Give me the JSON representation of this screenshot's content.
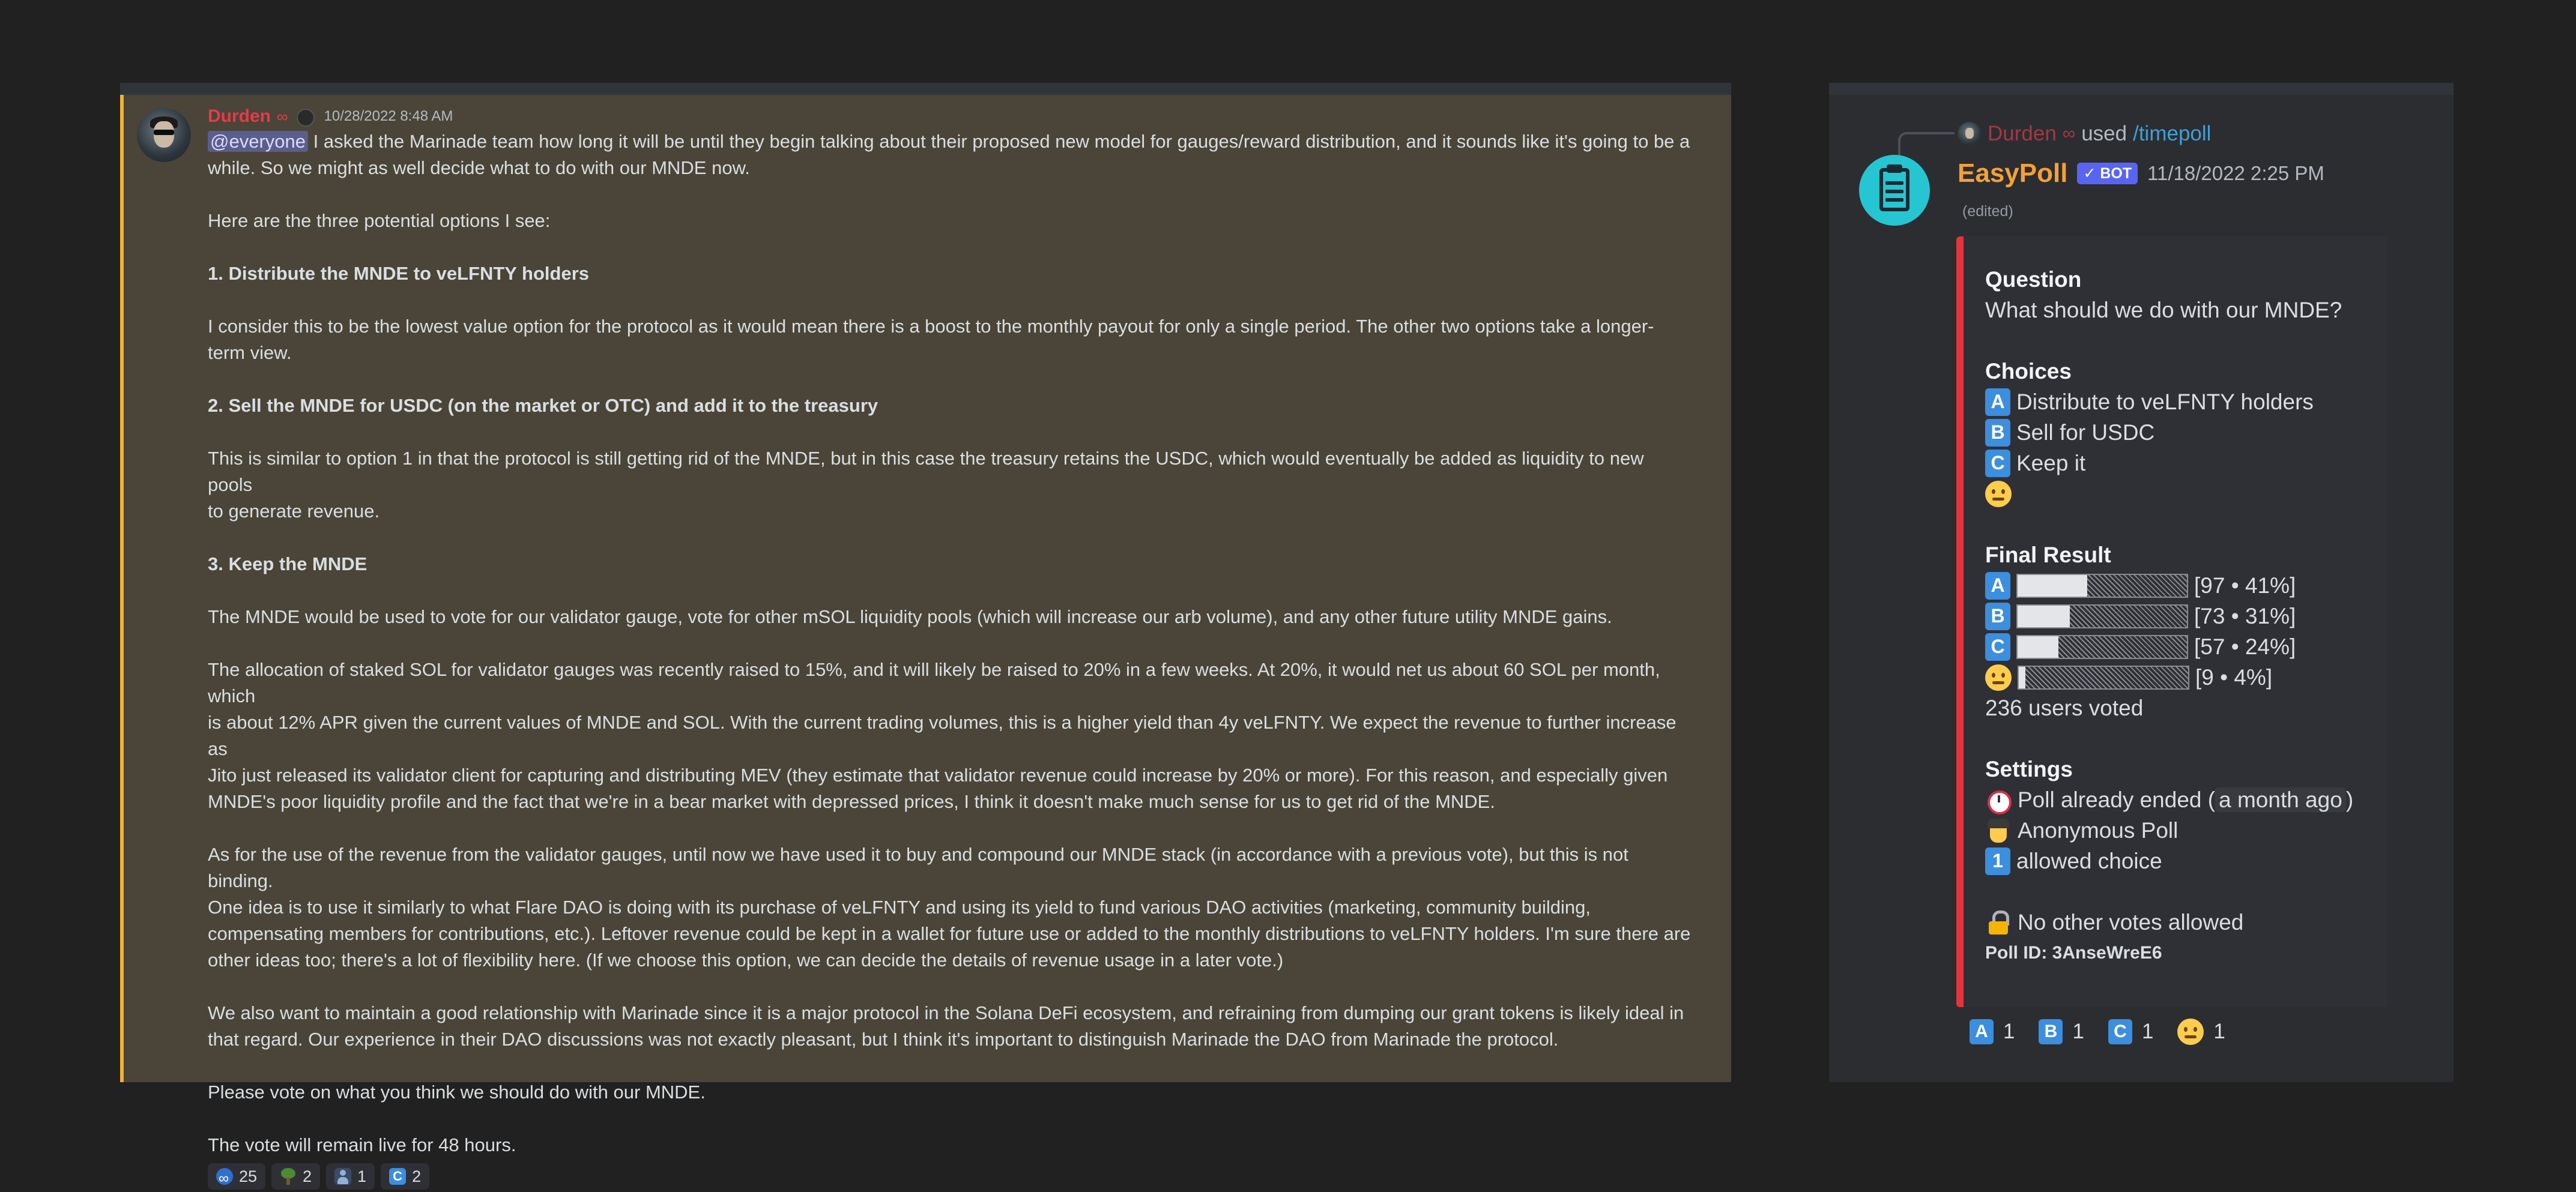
{
  "announcement": {
    "author": "Durden",
    "author_deco": "∞",
    "timestamp": "10/28/2022 8:48 AM",
    "mention": "@everyone",
    "intro_rest": " I asked the Marinade team how long it will be until they begin talking about their proposed new model for gauges/reward distribution, and it sounds like it's going to be a",
    "intro_line2": "while. So we might as well decide what to do with our MNDE now.",
    "options_intro": "Here are the three potential options I see:",
    "opt1_title": "1. Distribute the MNDE to veLFNTY holders",
    "opt1_line1": "I consider this to be the lowest value option for the protocol as it would mean there is a boost to the monthly payout for only a single period. The other two options take a longer-",
    "opt1_line2": "term view.",
    "opt2_title": "2. Sell the MNDE for USDC (on the market or OTC) and add it to the treasury",
    "opt2_line1": "This is similar to option 1 in that the protocol is still getting rid of the MNDE, but in this case the treasury retains the USDC, which would eventually be added as liquidity to new pools",
    "opt2_line2": "to generate revenue.",
    "opt3_title": "3. Keep the MNDE",
    "opt3_line1": "The MNDE would be used to vote for our validator gauge, vote for other mSOL liquidity pools (which will increase our arb volume), and any other future utility MNDE gains.",
    "alloc_line1": "The allocation of staked SOL for validator gauges was recently raised to 15%, and it will likely be raised to 20% in a few weeks. At 20%, it would net us about 60 SOL per month, which",
    "alloc_line2": "is about 12% APR given the current values of MNDE and SOL. With the current trading volumes, this is a higher yield than 4y veLFNTY. We expect the revenue to further increase as",
    "alloc_line3": "Jito just released its validator client for capturing and distributing MEV (they estimate that validator revenue could increase by 20% or more). For this reason, and especially given",
    "alloc_line4": "MNDE's poor liquidity profile and the fact that we're in a bear market with depressed prices, I think it doesn't make much sense for us to get rid of the MNDE.",
    "rev_line1": "As for the use of the revenue from the validator gauges, until now we have used it to buy and compound our MNDE stack (in accordance with a previous vote), but this is not binding.",
    "rev_line2": "One idea is to use it similarly to what Flare DAO is doing with its purchase of veLFNTY and using its yield to fund various DAO activities (marketing, community building,",
    "rev_line3": "compensating members for contributions, etc.). Leftover revenue could be kept in a wallet for future use or added to the monthly distributions to veLFNTY holders. I'm sure there are",
    "rev_line4": "other ideas too; there's a lot of flexibility here. (If we choose this option, we can decide the details of revenue usage in a later vote.)",
    "rel_line1": "We also want to maintain a good relationship with Marinade since it is a major protocol in the Solana DeFi ecosystem, and refraining from dumping our grant tokens is likely ideal in",
    "rel_line2": "that regard. Our experience in their DAO discussions was not exactly pleasant, but I think it's important to distinguish Marinade the DAO from Marinade the protocol.",
    "vote_line": "Please vote on what you think we should do with our MNDE.",
    "live_line": "The vote will remain live for 48 hours.",
    "reactions": [
      {
        "icon": "marinade-icon",
        "count": "25"
      },
      {
        "icon": "tree-icon",
        "count": "2"
      },
      {
        "icon": "person-icon",
        "count": "1"
      },
      {
        "icon": "letter-c-icon",
        "letter": "C",
        "count": "2"
      }
    ]
  },
  "poll": {
    "reply_author": "Durden",
    "reply_deco": "∞",
    "reply_used": "used",
    "reply_command": "/timepoll",
    "bot_name": "EasyPoll",
    "bot_badge": "✓ BOT",
    "bot_time": "11/18/2022 2:25 PM",
    "edited": "(edited)",
    "question_title": "Question",
    "question": "What should we do with our MNDE?",
    "choices_title": "Choices",
    "choices": [
      {
        "letter": "A",
        "label": "Distribute to veLFNTY holders"
      },
      {
        "letter": "B",
        "label": "Sell for USDC"
      },
      {
        "letter": "C",
        "label": "Keep it"
      }
    ],
    "result_title": "Final Result",
    "results": [
      {
        "letter": "A",
        "fraction": 0.41,
        "label": "[97 • 41%]"
      },
      {
        "letter": "B",
        "fraction": 0.31,
        "label": "[73 • 31%]"
      },
      {
        "letter": "C",
        "fraction": 0.24,
        "label": "[57 • 24%]"
      },
      {
        "letter": "",
        "fraction": 0.04,
        "label": "[9 • 4%]"
      }
    ],
    "voted": "236 users voted",
    "settings_title": "Settings",
    "ended_text": "Poll already ended (",
    "ended_ago": "a month ago",
    "ended_close": ")",
    "anonymous": "Anonymous Poll",
    "allowed_num": "1",
    "allowed": "allowed choice",
    "no_votes": "No other votes allowed",
    "poll_id": "Poll ID: 3AnseWreE6",
    "reactions": [
      {
        "letter": "A",
        "count": "1"
      },
      {
        "letter": "B",
        "count": "1"
      },
      {
        "letter": "C",
        "count": "1"
      },
      {
        "letter": "",
        "count": "1"
      }
    ]
  },
  "colors": {
    "background": "#212121",
    "panel": "#2b2d31",
    "highlight": "#4a4538",
    "highlight_border": "#f0b132",
    "author": "#e8394a",
    "bot_name": "#f4a038",
    "embed_border": "#e8323c",
    "letter_box": "#3c8ede",
    "command": "#3fa0d8"
  }
}
